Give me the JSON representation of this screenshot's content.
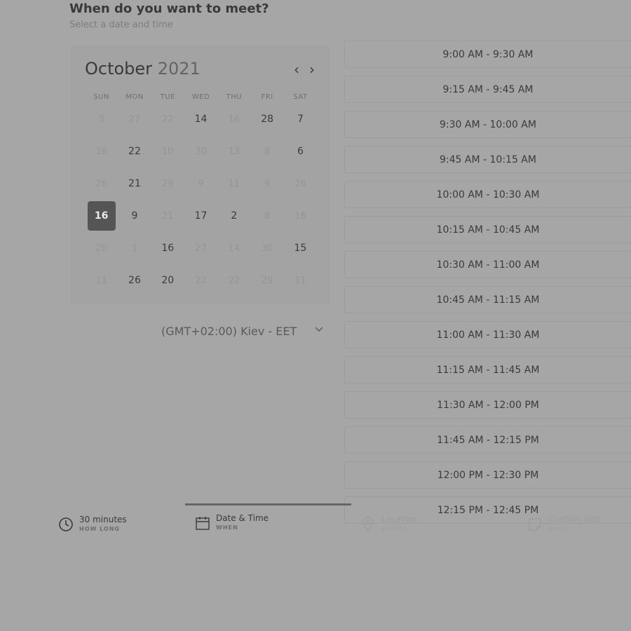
{
  "header": {
    "title": "When do you want to meet?",
    "subtitle": "Select a date and time"
  },
  "calendar": {
    "month": "October",
    "year": "2021",
    "prev_icon": "chevron-left-icon",
    "next_icon": "chevron-right-icon",
    "weekdays": [
      "SUN",
      "MON",
      "TUE",
      "WED",
      "THU",
      "FRI",
      "SAT"
    ],
    "weeks": [
      [
        {
          "d": "3",
          "m": true
        },
        {
          "d": "27",
          "m": true
        },
        {
          "d": "22",
          "m": true
        },
        {
          "d": "14",
          "m": false
        },
        {
          "d": "16",
          "m": true
        },
        {
          "d": "28",
          "m": false
        },
        {
          "d": "7",
          "m": false
        }
      ],
      [
        {
          "d": "16",
          "m": true
        },
        {
          "d": "22",
          "m": false
        },
        {
          "d": "10",
          "m": true
        },
        {
          "d": "30",
          "m": true
        },
        {
          "d": "13",
          "m": true
        },
        {
          "d": "8",
          "m": true
        },
        {
          "d": "6",
          "m": false
        }
      ],
      [
        {
          "d": "26",
          "m": true
        },
        {
          "d": "21",
          "m": false
        },
        {
          "d": "29",
          "m": true
        },
        {
          "d": "9",
          "m": true
        },
        {
          "d": "11",
          "m": true
        },
        {
          "d": "9",
          "m": true
        },
        {
          "d": "26",
          "m": true
        }
      ],
      [
        {
          "d": "16",
          "m": false,
          "selected": true
        },
        {
          "d": "9",
          "m": false
        },
        {
          "d": "21",
          "m": true
        },
        {
          "d": "17",
          "m": false
        },
        {
          "d": "2",
          "m": false
        },
        {
          "d": "8",
          "m": true
        },
        {
          "d": "16",
          "m": true
        }
      ],
      [
        {
          "d": "20",
          "m": true
        },
        {
          "d": "1",
          "m": true
        },
        {
          "d": "16",
          "m": false
        },
        {
          "d": "27",
          "m": true
        },
        {
          "d": "14",
          "m": true
        },
        {
          "d": "30",
          "m": true
        },
        {
          "d": "15",
          "m": false
        }
      ],
      [
        {
          "d": "11",
          "m": true
        },
        {
          "d": "26",
          "m": false
        },
        {
          "d": "20",
          "m": false
        },
        {
          "d": "22",
          "m": true
        },
        {
          "d": "22",
          "m": true
        },
        {
          "d": "29",
          "m": true
        },
        {
          "d": "11",
          "m": true
        }
      ]
    ]
  },
  "timezone": {
    "value": "(GMT+02:00) Kiev - EET",
    "icon": "chevron-down-icon"
  },
  "slots": [
    "9:00 AM - 9:30 AM",
    "9:15 AM - 9:45 AM",
    "9:30 AM - 10:00 AM",
    "9:45 AM - 10:15 AM",
    "10:00 AM - 10:30 AM",
    "10:15 AM - 10:45 AM",
    "10:30 AM - 11:00 AM",
    "10:45 AM - 11:15 AM",
    "11:00 AM - 11:30 AM",
    "11:15 AM - 11:45 AM",
    "11:30 AM - 12:00 PM",
    "11:45 AM - 12:15 PM",
    "12:00 PM - 12:30 PM",
    "12:15 PM - 12:45 PM"
  ],
  "steps": [
    {
      "label": "30 minutes",
      "sub": "HOW LONG",
      "icon": "clock-icon"
    },
    {
      "label": "Date & Time",
      "sub": "WHEN",
      "icon": "calendar-icon"
    },
    {
      "label": "Location",
      "sub": "WHERE",
      "icon": "location-pin-icon"
    },
    {
      "label": "Confirm Info",
      "sub": "WHO",
      "icon": "note-icon"
    }
  ],
  "colors": {
    "selected_day": "#555555",
    "progress": "#666666"
  }
}
